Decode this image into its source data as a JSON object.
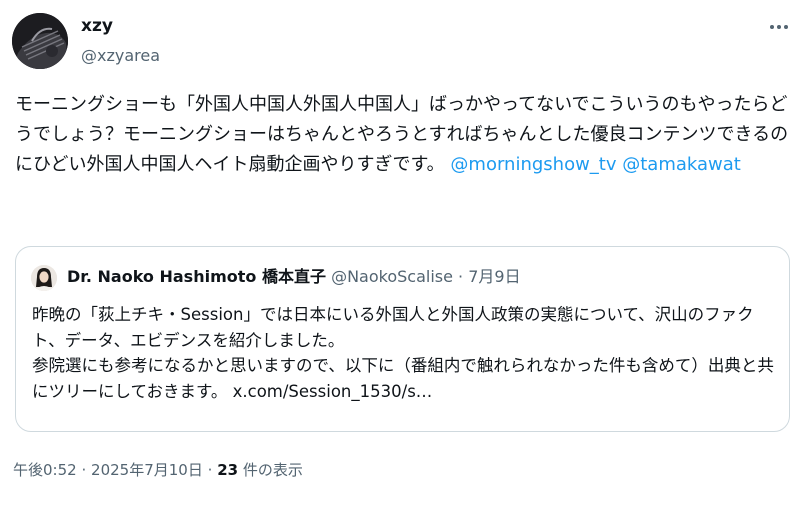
{
  "author": {
    "display_name": "xzy",
    "handle": "@xzyarea"
  },
  "tweet": {
    "text": "モーニングショーも「外国人中国人外国人中国人」ばっかやってないでこういうのもやったらどうでしょう？モーニングショーはちゃんとやろうとすればちゃんとした優良コンテンツできるのにひどい外国人中国人ヘイト扇動企画やりすぎです。",
    "mentions": [
      "@morningshow_tv",
      "@tamakawat"
    ]
  },
  "quoted": {
    "display_name": "Dr. Naoko Hashimoto 橋本直子",
    "handle": "@NaokoScalise",
    "separator": "·",
    "date": "7月9日",
    "text_line1": "昨晩の「荻上チキ・Session」では日本にいる外国人と外国人政策の実態について、沢山のファクト、データ、エビデンスを紹介しました。",
    "text_line2": "参院選にも参考になるかと思いますので、以下に（番組内で触れられなかった件も含めて）出典と共にツリーにしておきます。",
    "link": "x.com/Session_1530/s…"
  },
  "footer": {
    "time": "午後0:52",
    "separator1": "·",
    "date": "2025年7月10日",
    "separator2": "·",
    "views_count": "23",
    "views_label": "件の表示"
  },
  "icons": {
    "more": "more-horizontal-icon",
    "avatar": "user-avatar",
    "quoted_avatar": "quoted-user-avatar"
  },
  "colors": {
    "link": "#1d9bf0",
    "text": "#0f1419",
    "secondary": "#536471",
    "border": "#cfd9de"
  }
}
